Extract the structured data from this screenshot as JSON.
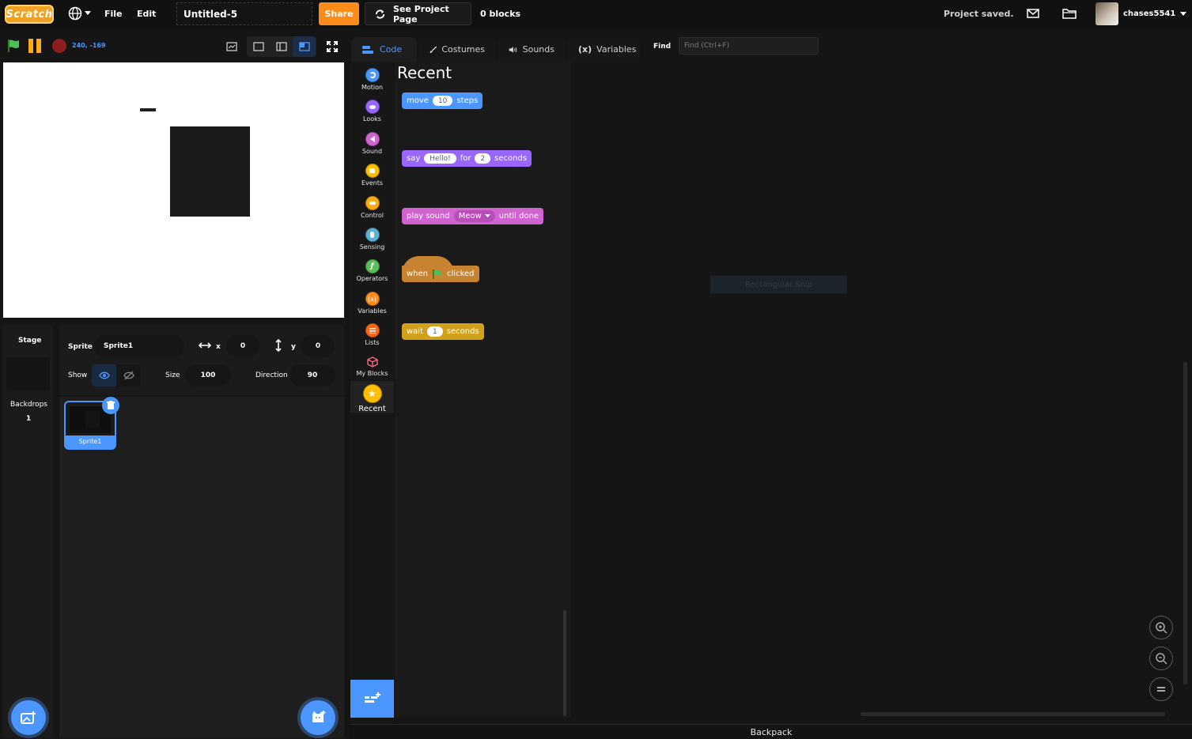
{
  "menubar": {
    "logo_text": "Scratch",
    "globe_icon": "globe-icon",
    "file_label": "File",
    "edit_label": "Edit",
    "project_title": "Untitled-5",
    "share_label": "Share",
    "see_project_label": "See Project Page",
    "block_count": "0 blocks",
    "status": "Project saved.",
    "username": "chases5541"
  },
  "stage": {
    "coords": "240, -169"
  },
  "sprite_info": {
    "sprite_label": "Sprite",
    "sprite_name": "Sprite1",
    "x_label": "x",
    "x_value": "0",
    "y_label": "y",
    "y_value": "0",
    "show_label": "Show",
    "size_label": "Size",
    "size_value": "100",
    "direction_label": "Direction",
    "direction_value": "90"
  },
  "stage_panel": {
    "stage_label": "Stage",
    "backdrops_label": "Backdrops",
    "backdrops_count": "1"
  },
  "sprite_list": [
    {
      "name": "Sprite1"
    }
  ],
  "tabs": {
    "code": "Code",
    "costumes": "Costumes",
    "sounds": "Sounds",
    "variables": "Variables",
    "find_label": "Find",
    "find_placeholder": "Find (Ctrl+F)"
  },
  "categories": [
    {
      "label": "Motion",
      "color": "#4c97ff"
    },
    {
      "label": "Looks",
      "color": "#9966ff"
    },
    {
      "label": "Sound",
      "color": "#cf63cf"
    },
    {
      "label": "Events",
      "color": "#ffbf00"
    },
    {
      "label": "Control",
      "color": "#ffab19"
    },
    {
      "label": "Sensing",
      "color": "#5cb1d6"
    },
    {
      "label": "Operators",
      "color": "#59c059"
    },
    {
      "label": "Variables",
      "color": "#ff8c1a"
    },
    {
      "label": "Lists",
      "color": "#ff661a"
    },
    {
      "label": "My Blocks",
      "color": "#ff6680"
    },
    {
      "label": "Recent",
      "color": "#ffbf00"
    }
  ],
  "palette": {
    "heading": "Recent",
    "move": {
      "pre": "move",
      "val": "10",
      "post": "steps"
    },
    "say": {
      "pre": "say",
      "val": "Hello!",
      "mid": "for",
      "val2": "2",
      "post": "seconds"
    },
    "play": {
      "pre": "play sound",
      "val": "Meow",
      "post": "until done"
    },
    "when": {
      "pre": "when",
      "post": "clicked"
    },
    "wait": {
      "pre": "wait",
      "val": "1",
      "post": "seconds"
    }
  },
  "workspace": {
    "ghost_label": "Rectangular Snip"
  },
  "backpack_label": "Backpack"
}
